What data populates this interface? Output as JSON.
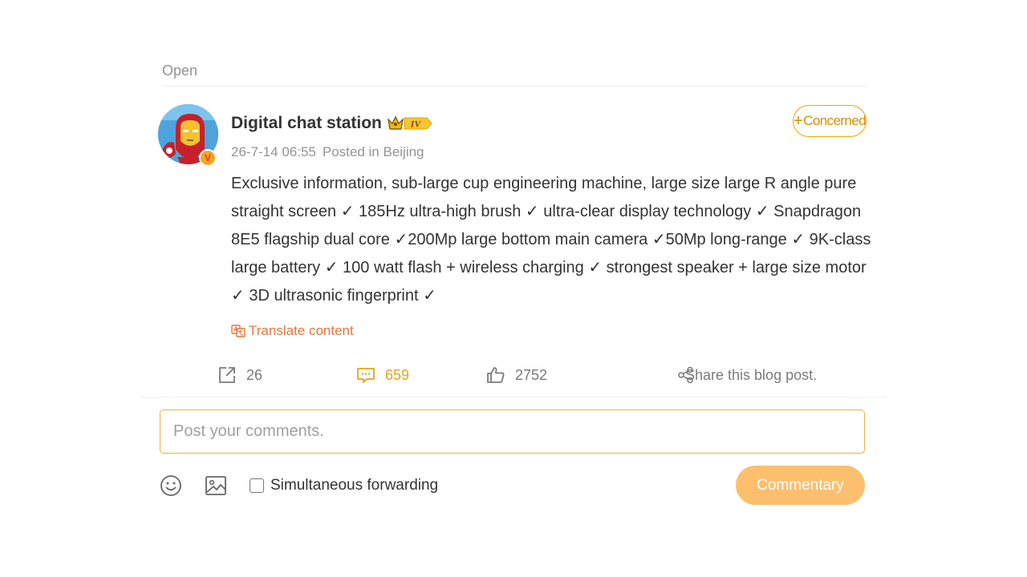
{
  "header": {
    "open_label": "Open"
  },
  "post": {
    "author_name": "Digital chat station",
    "level_badge": "IV",
    "timestamp": "26-7-14 06:55",
    "location": "Posted in Beijing",
    "follow_label": "Concerned",
    "follow_symbol": "+",
    "verified_mark": "V",
    "content": "Exclusive information, sub-large cup engineering machine, large size large R angle pure straight screen ✓ 185Hz ultra-high brush ✓ ultra-clear display technology ✓ Snapdragon 8E5 flagship dual core ✓200Mp large bottom main camera ✓50Mp long-range ✓ 9K-class large battery ✓ 100 watt flash + wireless charging ✓ strongest speaker + large size motor ✓ 3D ultrasonic fingerprint ✓",
    "translate_label": "Translate content"
  },
  "actions": {
    "forward_count": "26",
    "comment_count": "659",
    "like_count": "2752",
    "share_label": "Share this blog post."
  },
  "composer": {
    "placeholder": "Post your comments.",
    "forwarding_label": "Simultaneous forwarding",
    "submit_label": "Commentary"
  },
  "colors": {
    "accent": "#e8a317",
    "translate": "#e8743b",
    "submit_bg": "#fcbf6e",
    "muted": "#939393"
  },
  "icons": {
    "avatar": "iron-man-avatar",
    "verified": "verified-badge-icon",
    "crown": "crown-icon",
    "translate": "translate-icon",
    "forward": "forward-icon",
    "comment": "comment-icon",
    "like": "thumbs-up-icon",
    "share": "share-icon",
    "emoji": "emoji-icon",
    "image": "image-icon"
  }
}
